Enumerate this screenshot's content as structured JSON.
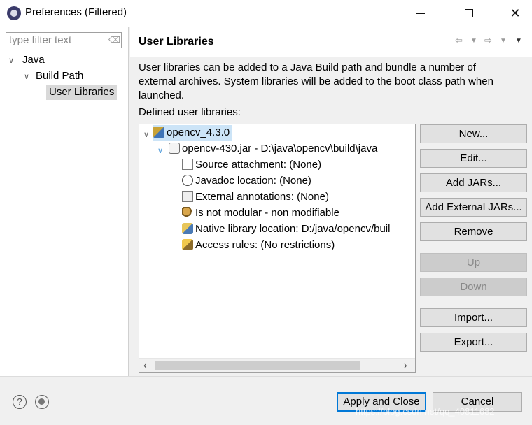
{
  "window": {
    "title": "Preferences (Filtered)"
  },
  "filter": {
    "placeholder": "type filter text"
  },
  "nav": {
    "items": [
      {
        "label": "Java"
      },
      {
        "label": "Build Path"
      },
      {
        "label": "User Libraries"
      }
    ]
  },
  "page": {
    "title": "User Libraries",
    "description_line1": "User libraries can be added to a Java Build path and bundle a number of",
    "description_line2": "external archives. System libraries will be added to the boot class path when",
    "description_line3": "launched.",
    "defined_label": "Defined user libraries:"
  },
  "tree": {
    "library": "opencv_4.3.0",
    "jar": "opencv-430.jar - D:\\java\\opencv\\build\\java",
    "attributes": [
      {
        "label": "Source attachment: (None)",
        "icon": "source-attachment-icon"
      },
      {
        "label": "Javadoc location: (None)",
        "icon": "javadoc-icon"
      },
      {
        "label": "External annotations: (None)",
        "icon": "annotations-icon"
      },
      {
        "label": "Is not modular - non modifiable",
        "icon": "module-icon"
      },
      {
        "label": "Native library location: D:/java/opencv/buil",
        "icon": "native-library-icon"
      },
      {
        "label": "Access rules: (No restrictions)",
        "icon": "access-rules-icon"
      }
    ]
  },
  "buttons": {
    "new": "New...",
    "edit": "Edit...",
    "add_jars": "Add JARs...",
    "add_external_jars": "Add External JARs...",
    "remove": "Remove",
    "up": "Up",
    "down": "Down",
    "import": "Import...",
    "export": "Export..."
  },
  "footer": {
    "apply_close": "Apply and Close",
    "cancel": "Cancel",
    "watermark": "https://blog.csdn.net/qq_40811682"
  },
  "colors": {
    "selection": "#cce4f7",
    "default_button_border": "#0078d7",
    "nav_selected": "#d9d9d9"
  }
}
